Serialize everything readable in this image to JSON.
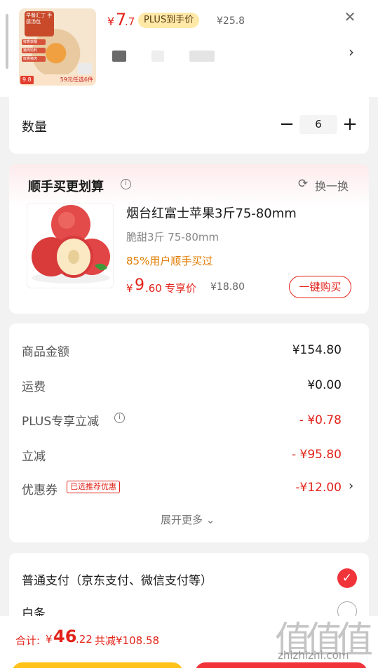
{
  "product": {
    "price_symbol": "¥",
    "price_int": "7",
    "price_dec": ".7",
    "plus_badge": "PLUS到手价",
    "original_price": "¥25.8",
    "thumb_banner": "早餐汇丁 手感汤包",
    "thumb_pill_1": "鲜香软糯",
    "thumb_pill_2": "猪肉馅料",
    "thumb_pill_3": "鲜香猪肉",
    "thumb_price": "9.8",
    "thumb_promo": "59元任选6件"
  },
  "quantity": {
    "label": "数量",
    "minus": "−",
    "value": "6",
    "plus": "+"
  },
  "addon": {
    "title": "顺手买更划算",
    "refresh_label": "换一换",
    "item": {
      "name": "烟台红富士苹果3斤75-80mm",
      "spec": "脆甜3斤 75-80mm",
      "tip": "85%用户顺手买过",
      "price_symbol": "¥",
      "price_int": "9",
      "price_dec": ".60",
      "share_label": "专享价",
      "original_price": "¥18.80",
      "buy_label": "一键购买"
    }
  },
  "amounts": {
    "goods": {
      "label": "商品金额",
      "value": "¥154.80"
    },
    "shipping": {
      "label": "运费",
      "value": "¥0.00"
    },
    "plus_cut": {
      "label": "PLUS专享立减",
      "value": "- ¥0.78"
    },
    "cut": {
      "label": "立减",
      "value": "- ¥95.80"
    },
    "coupon": {
      "label": "优惠券",
      "tag": "已选推荐优惠",
      "value": "-¥12.00"
    },
    "expand_more": "展开更多"
  },
  "payment": {
    "normal": "普通支付（京东支付、微信支付等）",
    "baitiao": "白条"
  },
  "footer": {
    "total_label": "合计:",
    "total_symbol": "¥",
    "total_int": "46",
    "total_dec": ".22",
    "total_saving": "共减¥108.58",
    "watermark_text": "zhizhizhi.com"
  },
  "colors": {
    "accent_red": "#e2231a",
    "plus_gold": "#ffe9a8",
    "tip_orange": "#e07b00",
    "pay_yellow": "#ffc21a"
  }
}
